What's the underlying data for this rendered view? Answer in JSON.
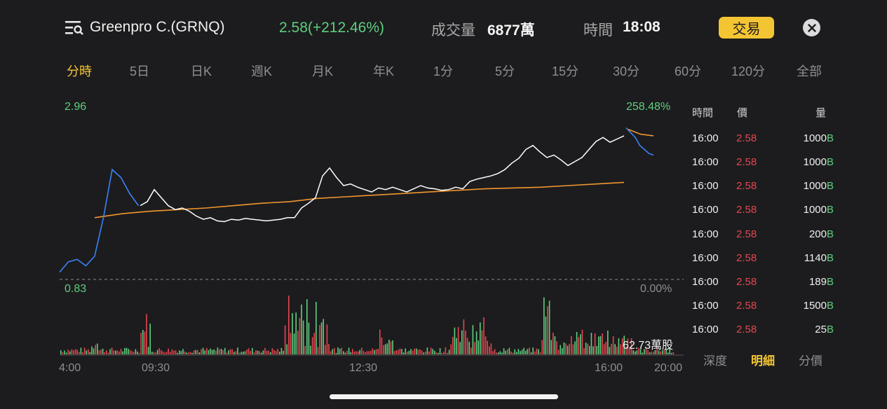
{
  "header": {
    "title": "Greenpro C.(GRNQ)",
    "price": "2.58(+212.46%)",
    "volume_label": "成交量",
    "volume_value": "6877萬",
    "time_label": "時間",
    "time_value": "18:08",
    "trade_button": "交易",
    "menu_icon": "search-list-icon",
    "close_icon": "close-icon"
  },
  "tabs": [
    {
      "label": "分時",
      "active": true
    },
    {
      "label": "5日"
    },
    {
      "label": "日K"
    },
    {
      "label": "週K"
    },
    {
      "label": "月K"
    },
    {
      "label": "年K"
    },
    {
      "label": "1分"
    },
    {
      "label": "5分"
    },
    {
      "label": "15分"
    },
    {
      "label": "30分"
    },
    {
      "label": "60分"
    },
    {
      "label": "120分"
    },
    {
      "label": "全部"
    }
  ],
  "chart": {
    "y_high": "2.96",
    "y_low": "0.83",
    "pct_high": "258.48%",
    "pct_low": "0.00%",
    "volume_max": "62.73萬股",
    "x_ticks": [
      "4:00",
      "09:30",
      "12:30",
      "16:00",
      "20:00"
    ]
  },
  "chart_data": {
    "type": "line",
    "series": [
      {
        "name": "price",
        "values": [
          0.92,
          1.05,
          1.08,
          1.0,
          1.12,
          1.6,
          2.2,
          2.1,
          1.9,
          1.75,
          1.8,
          1.95,
          1.85,
          1.75,
          1.7,
          1.72,
          1.68,
          1.62,
          1.58,
          1.6,
          1.56,
          1.55,
          1.58,
          1.57,
          1.59,
          1.58,
          1.57,
          1.56,
          1.57,
          1.58,
          1.6,
          1.6,
          1.72,
          1.78,
          1.85,
          2.12,
          2.22,
          2.1,
          2.0,
          2.02,
          1.98,
          1.95,
          1.92,
          1.97,
          1.95,
          1.98,
          1.95,
          1.92,
          1.96,
          2.0,
          1.97,
          1.96,
          1.94,
          1.95,
          1.98,
          1.96,
          2.05,
          2.08,
          2.1,
          2.12,
          2.15,
          2.2,
          2.28,
          2.34,
          2.45,
          2.5,
          2.42,
          2.35,
          2.38,
          2.32,
          2.25,
          2.3,
          2.35,
          2.45,
          2.55,
          2.6,
          2.54,
          2.58,
          2.62
        ]
      },
      {
        "name": "avg",
        "values": [
          1.6,
          1.65,
          1.68,
          1.7,
          1.72,
          1.75,
          1.78,
          1.8,
          1.84,
          1.86,
          1.88,
          1.9,
          1.92,
          1.94,
          1.96,
          1.97,
          1.98,
          2.0,
          2.02,
          2.04
        ]
      }
    ],
    "ylim": [
      0.83,
      2.96
    ],
    "x": [
      "4:00",
      "09:30",
      "12:30",
      "16:00",
      "20:00"
    ]
  },
  "trades": {
    "headers": {
      "time": "時間",
      "price": "價",
      "volume": "量"
    },
    "rows": [
      {
        "time": "16:00",
        "price": "2.58",
        "volume": "1000",
        "side": "B"
      },
      {
        "time": "16:00",
        "price": "2.58",
        "volume": "1000",
        "side": "B"
      },
      {
        "time": "16:00",
        "price": "2.58",
        "volume": "1000",
        "side": "B"
      },
      {
        "time": "16:00",
        "price": "2.58",
        "volume": "1000",
        "side": "B"
      },
      {
        "time": "16:00",
        "price": "2.58",
        "volume": "200",
        "side": "B"
      },
      {
        "time": "16:00",
        "price": "2.58",
        "volume": "1140",
        "side": "B"
      },
      {
        "time": "16:00",
        "price": "2.58",
        "volume": "189",
        "side": "B"
      },
      {
        "time": "16:00",
        "price": "2.58",
        "volume": "1500",
        "side": "B"
      },
      {
        "time": "16:00",
        "price": "2.58",
        "volume": "25",
        "side": "B"
      }
    ],
    "tabs": [
      "深度",
      "明細",
      "分價"
    ]
  },
  "colors": {
    "up": "#5fce7e",
    "down": "#e3474f",
    "accent": "#f4c533",
    "pre": "#3b82f6",
    "avg": "#f0962f"
  }
}
